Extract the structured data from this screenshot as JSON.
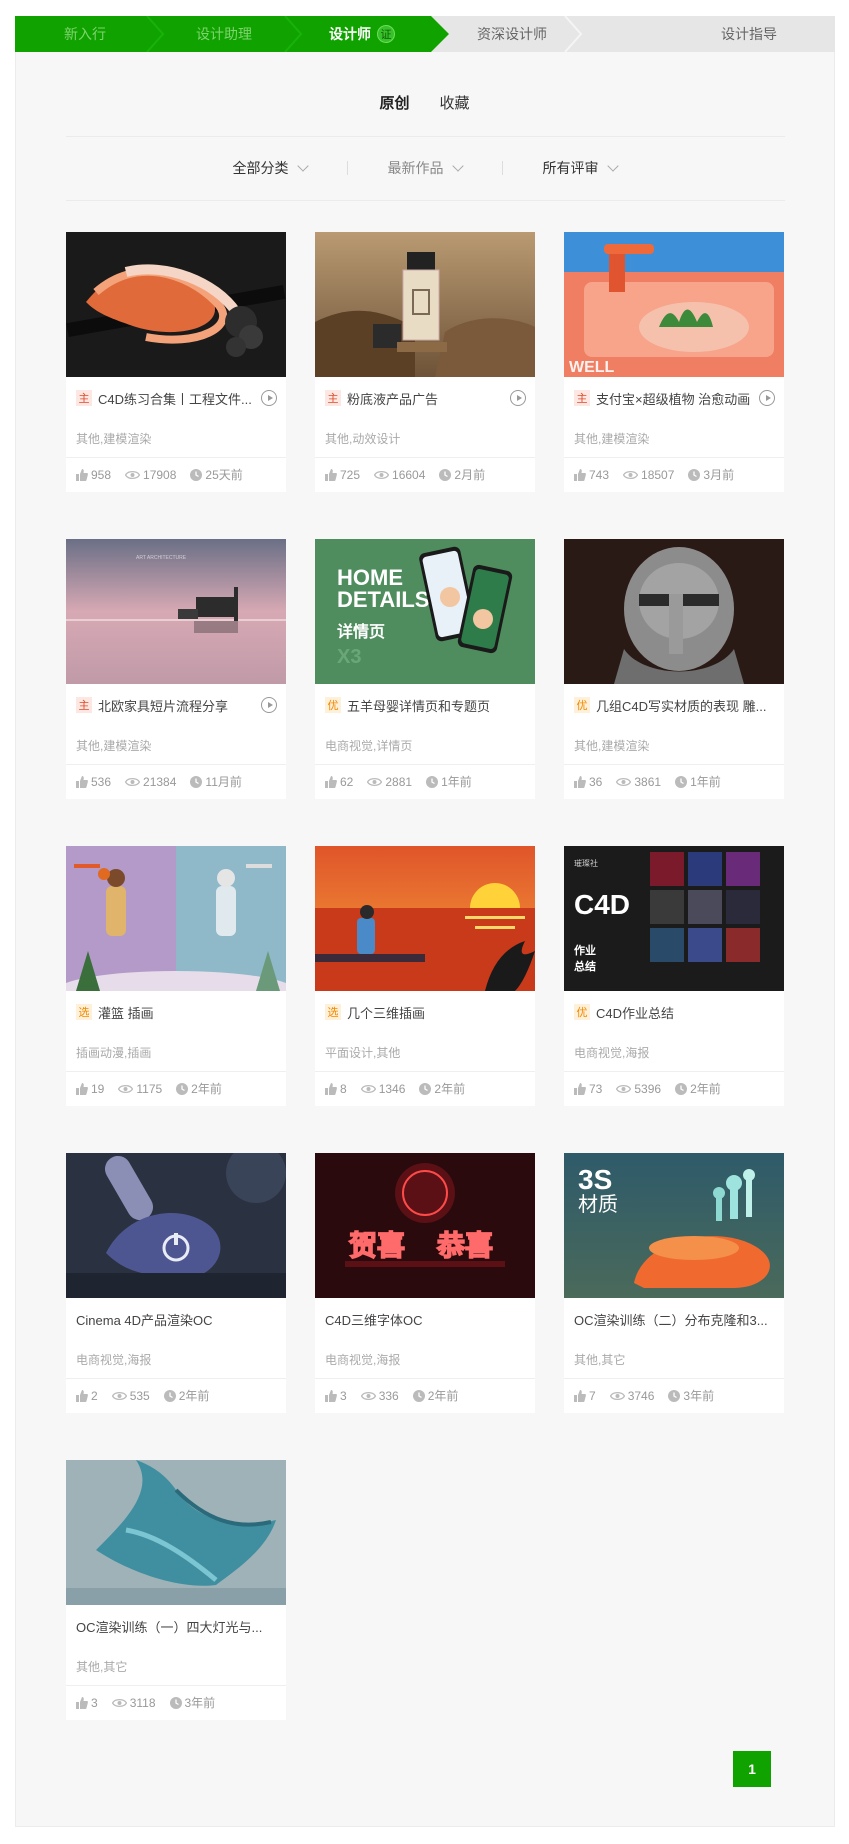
{
  "steps": [
    {
      "label": "新入行",
      "state": "done"
    },
    {
      "label": "设计助理",
      "state": "done"
    },
    {
      "label": "设计师",
      "state": "current",
      "badge": "证"
    },
    {
      "label": "资深设计师",
      "state": "todo"
    },
    {
      "label": "设计指导",
      "state": "todo"
    }
  ],
  "tabs": [
    {
      "label": "原创",
      "active": true
    },
    {
      "label": "收藏",
      "active": false
    }
  ],
  "filters": {
    "category": "全部分类",
    "sort": "最新作品",
    "rating": "所有评审"
  },
  "colors": {
    "accent": "#10a300",
    "tag_main": "#e04a2a",
    "tag_good": "#f08a00"
  },
  "works": [
    {
      "tag": "主",
      "tag_color": "red",
      "title": "C4D练习合集丨工程文件...",
      "video": true,
      "cats": "其他,建模渲染",
      "likes": "958",
      "views": "17908",
      "time": "25天前",
      "thumb": "ribbon"
    },
    {
      "tag": "主",
      "tag_color": "red",
      "title": "粉底液产品广告",
      "video": true,
      "cats": "其他,动效设计",
      "likes": "725",
      "views": "16604",
      "time": "2月前",
      "thumb": "bottle"
    },
    {
      "tag": "主",
      "tag_color": "red",
      "title": "支付宝×超级植物 治愈动画",
      "video": true,
      "cats": "其他,建模渲染",
      "likes": "743",
      "views": "18507",
      "time": "3月前",
      "thumb": "plant"
    },
    {
      "tag": "主",
      "tag_color": "red",
      "title": "北欧家具短片流程分享",
      "video": true,
      "cats": "其他,建模渲染",
      "likes": "536",
      "views": "21384",
      "time": "11月前",
      "thumb": "sea"
    },
    {
      "tag": "优",
      "tag_color": "orange",
      "title": "五羊母婴详情页和专题页",
      "video": false,
      "cats": "电商视觉,详情页",
      "likes": "62",
      "views": "2881",
      "time": "1年前",
      "thumb": "home",
      "thumb_text": [
        "HOME",
        "DETAILS",
        "详情页",
        "X3"
      ]
    },
    {
      "tag": "优",
      "tag_color": "orange",
      "title": "几组C4D写实材质的表现 雕...",
      "video": false,
      "cats": "其他,建模渲染",
      "likes": "36",
      "views": "3861",
      "time": "1年前",
      "thumb": "helmet"
    },
    {
      "tag": "选",
      "tag_color": "orange",
      "title": "灌篮 插画",
      "video": false,
      "cats": "插画动漫,插画",
      "likes": "19",
      "views": "1175",
      "time": "2年前",
      "thumb": "dunk"
    },
    {
      "tag": "选",
      "tag_color": "orange",
      "title": "几个三维插画",
      "video": false,
      "cats": "平面设计,其他",
      "likes": "8",
      "views": "1346",
      "time": "2年前",
      "thumb": "sunset"
    },
    {
      "tag": "优",
      "tag_color": "orange",
      "title": "C4D作业总结",
      "video": false,
      "cats": "电商视觉,海报",
      "likes": "73",
      "views": "5396",
      "time": "2年前",
      "thumb": "c4d",
      "thumb_text": [
        "C4D",
        "作业",
        "总结",
        "璀璨社"
      ]
    },
    {
      "tag": "",
      "tag_color": "",
      "title": "Cinema 4D产品渲染OC",
      "video": false,
      "cats": "电商视觉,海报",
      "likes": "2",
      "views": "535",
      "time": "2年前",
      "thumb": "product"
    },
    {
      "tag": "",
      "tag_color": "",
      "title": "C4D三维字体OC",
      "video": false,
      "cats": "电商视觉,海报",
      "likes": "3",
      "views": "336",
      "time": "2年前",
      "thumb": "font3d",
      "thumb_text": [
        "贺喜",
        "恭喜"
      ]
    },
    {
      "tag": "",
      "tag_color": "",
      "title": "OC渲染训练（二）分布克隆和3...",
      "video": false,
      "cats": "其他,其它",
      "likes": "7",
      "views": "3746",
      "time": "3年前",
      "thumb": "material",
      "thumb_text": [
        "3S",
        "材质"
      ]
    },
    {
      "tag": "",
      "tag_color": "",
      "title": "OC渲染训练（一）四大灯光与...",
      "video": false,
      "cats": "其他,其它",
      "likes": "3",
      "views": "3118",
      "time": "3年前",
      "thumb": "cloth"
    }
  ],
  "pagination": {
    "current": "1"
  }
}
